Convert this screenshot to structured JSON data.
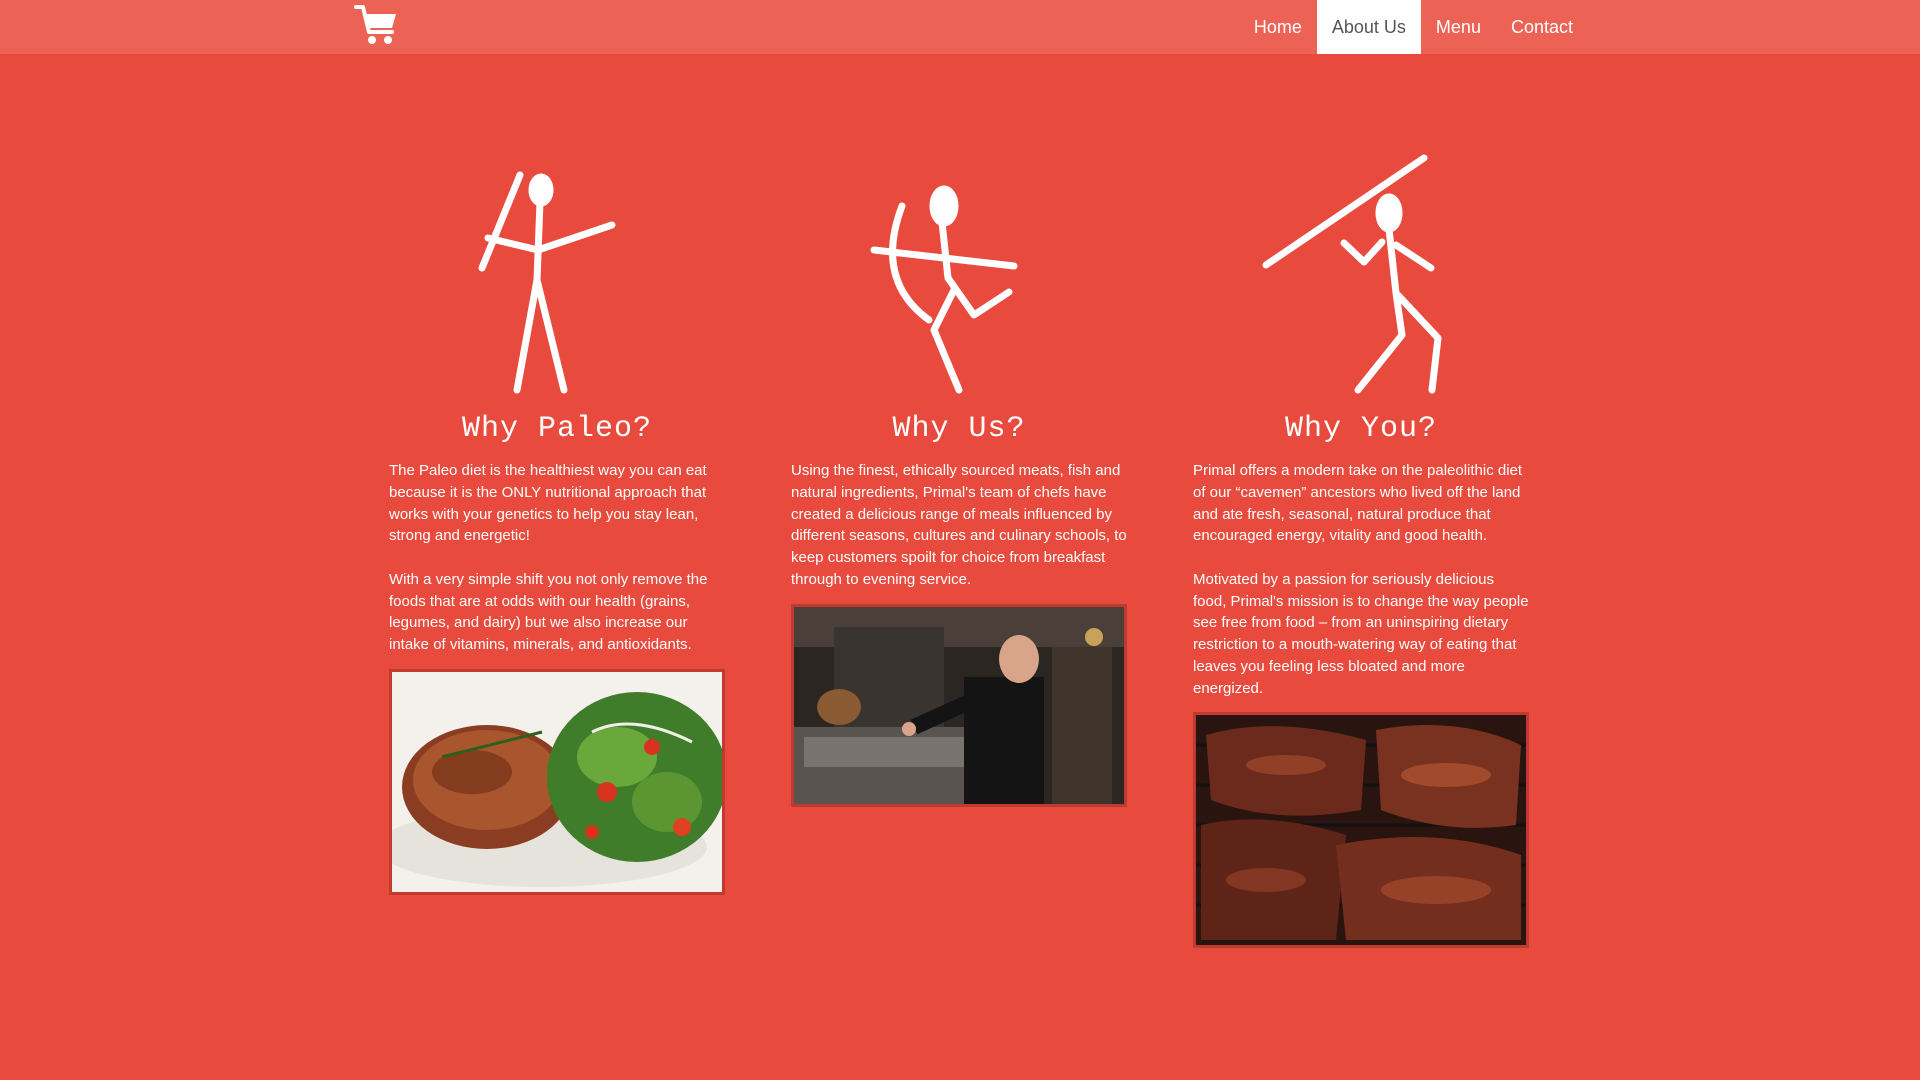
{
  "nav": {
    "logo_icon": "shopping-cart-icon",
    "items": [
      {
        "label": "Home",
        "active": false
      },
      {
        "label": "About Us",
        "active": true
      },
      {
        "label": "Menu",
        "active": false
      },
      {
        "label": "Contact",
        "active": false
      }
    ]
  },
  "colors": {
    "background": "#e84b3e",
    "navbar": "#ec6356",
    "active_nav_bg": "#ffffff",
    "text": "#ffffff"
  },
  "columns": [
    {
      "icon": "spear-thrower-figure-icon",
      "heading": "Why Paleo?",
      "paragraphs": [
        "The Paleo diet is the healthiest way you can eat because it is the ONLY nutritional approach that works with your genetics to help you stay lean, strong and energetic!",
        "With a very simple shift you not only remove the foods that are at odds with our health (grains, legumes, and dairy) but we also increase our intake of vitamins, minerals, and antioxidants."
      ],
      "image": "steak-and-salad-photo"
    },
    {
      "icon": "archer-figure-icon",
      "heading": "Why Us?",
      "paragraphs": [
        "Using the finest, ethically sourced meats, fish and natural ingredients, Primal's team of chefs have created a delicious range of meals influenced by different seasons, cultures and culinary schools, to keep customers spoilt for choice from breakfast through to evening service."
      ],
      "image": "chef-at-grill-photo"
    },
    {
      "icon": "javelin-thrower-figure-icon",
      "heading": "Why You?",
      "paragraphs": [
        "Primal offers a modern take on the paleolithic diet of our “cavemen” ancestors who lived off the land and ate fresh, seasonal, natural produce that encouraged energy, vitality and good health.",
        "Motivated by a passion for seriously delicious food, Primal's mission is to change the way people see free from food – from an uninspiring dietary restriction to a mouth-watering way of eating that leaves you feeling less bloated and more energized."
      ],
      "image": "grilled-ribs-photo"
    }
  ]
}
